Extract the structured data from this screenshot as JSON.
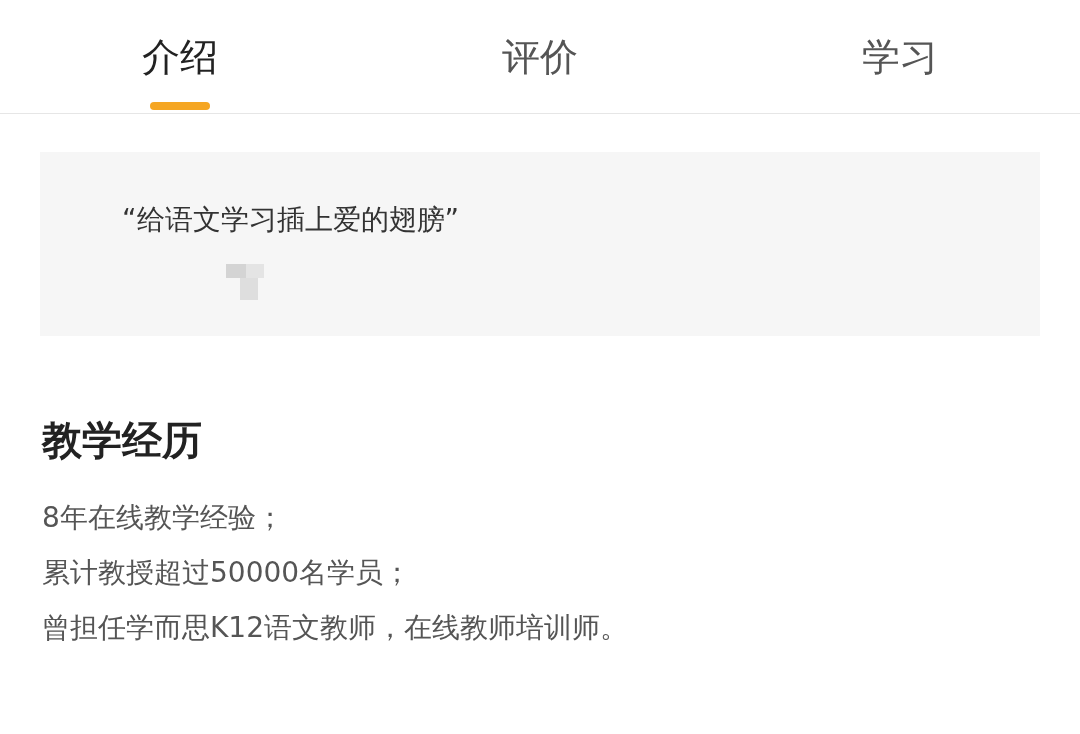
{
  "tabs": [
    {
      "label": "介绍",
      "selected": true
    },
    {
      "label": "评价",
      "selected": false
    },
    {
      "label": "学习",
      "selected": false
    }
  ],
  "motto": {
    "text": "“给语文学习插上爱的翅膀”"
  },
  "section": {
    "title": "教学经历",
    "lines": [
      "8年在线教学经验；",
      "累计教授超过50000名学员；",
      "曾担任学而思K12语文教师，在线教师培训师。"
    ]
  }
}
